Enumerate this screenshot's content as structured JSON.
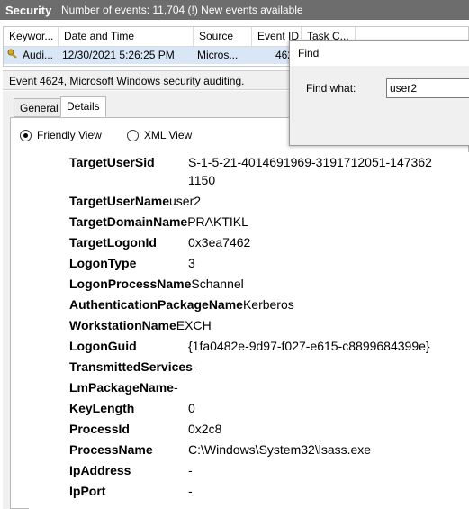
{
  "titlebar": {
    "title": "Security",
    "events_info": "Number of events: 11,704 (!) New events available"
  },
  "events_table": {
    "columns": [
      "Keywor...",
      "Date and Time",
      "Source",
      "Event ID",
      "Task C..."
    ],
    "selected_row": {
      "keyword": "Audi...",
      "date_time": "12/30/2021 5:26:25 PM",
      "source": "Micros...",
      "event_id": "462",
      "task_category": ""
    }
  },
  "event_summary": "Event 4624, Microsoft Windows security auditing.",
  "tabs": {
    "general": "General",
    "details": "Details"
  },
  "view_options": {
    "friendly": "Friendly View",
    "xml": "XML View",
    "selected": "friendly"
  },
  "details": [
    {
      "key": "TargetUserSid",
      "value": "S-1-5-21-4014691969-3191712051-147362"
    },
    {
      "key": "",
      "value": "1150"
    },
    {
      "key": "TargetUserName",
      "value": "user2"
    },
    {
      "key": "TargetDomainName",
      "value": "PRAKTIKL"
    },
    {
      "key": "TargetLogonId",
      "value": "0x3ea7462"
    },
    {
      "key": "LogonType",
      "value": "3"
    },
    {
      "key": "LogonProcessName",
      "value": "Schannel"
    },
    {
      "key": "AuthenticationPackageName",
      "value": "Kerberos"
    },
    {
      "key": "WorkstationName",
      "value": "EXCH"
    },
    {
      "key": "LogonGuid",
      "value": "{1fa0482e-9d97-f027-e615-c8899684399e}"
    },
    {
      "key": "TransmittedServices",
      "value": "-"
    },
    {
      "key": "LmPackageName",
      "value": "-"
    },
    {
      "key": "KeyLength",
      "value": "0"
    },
    {
      "key": "ProcessId",
      "value": "0x2c8"
    },
    {
      "key": "ProcessName",
      "value": "C:\\Windows\\System32\\lsass.exe"
    },
    {
      "key": "IpAddress",
      "value": "-"
    },
    {
      "key": "IpPort",
      "value": "-"
    }
  ],
  "find_dialog": {
    "title": "Find",
    "label": "Find what:",
    "value": "user2"
  }
}
